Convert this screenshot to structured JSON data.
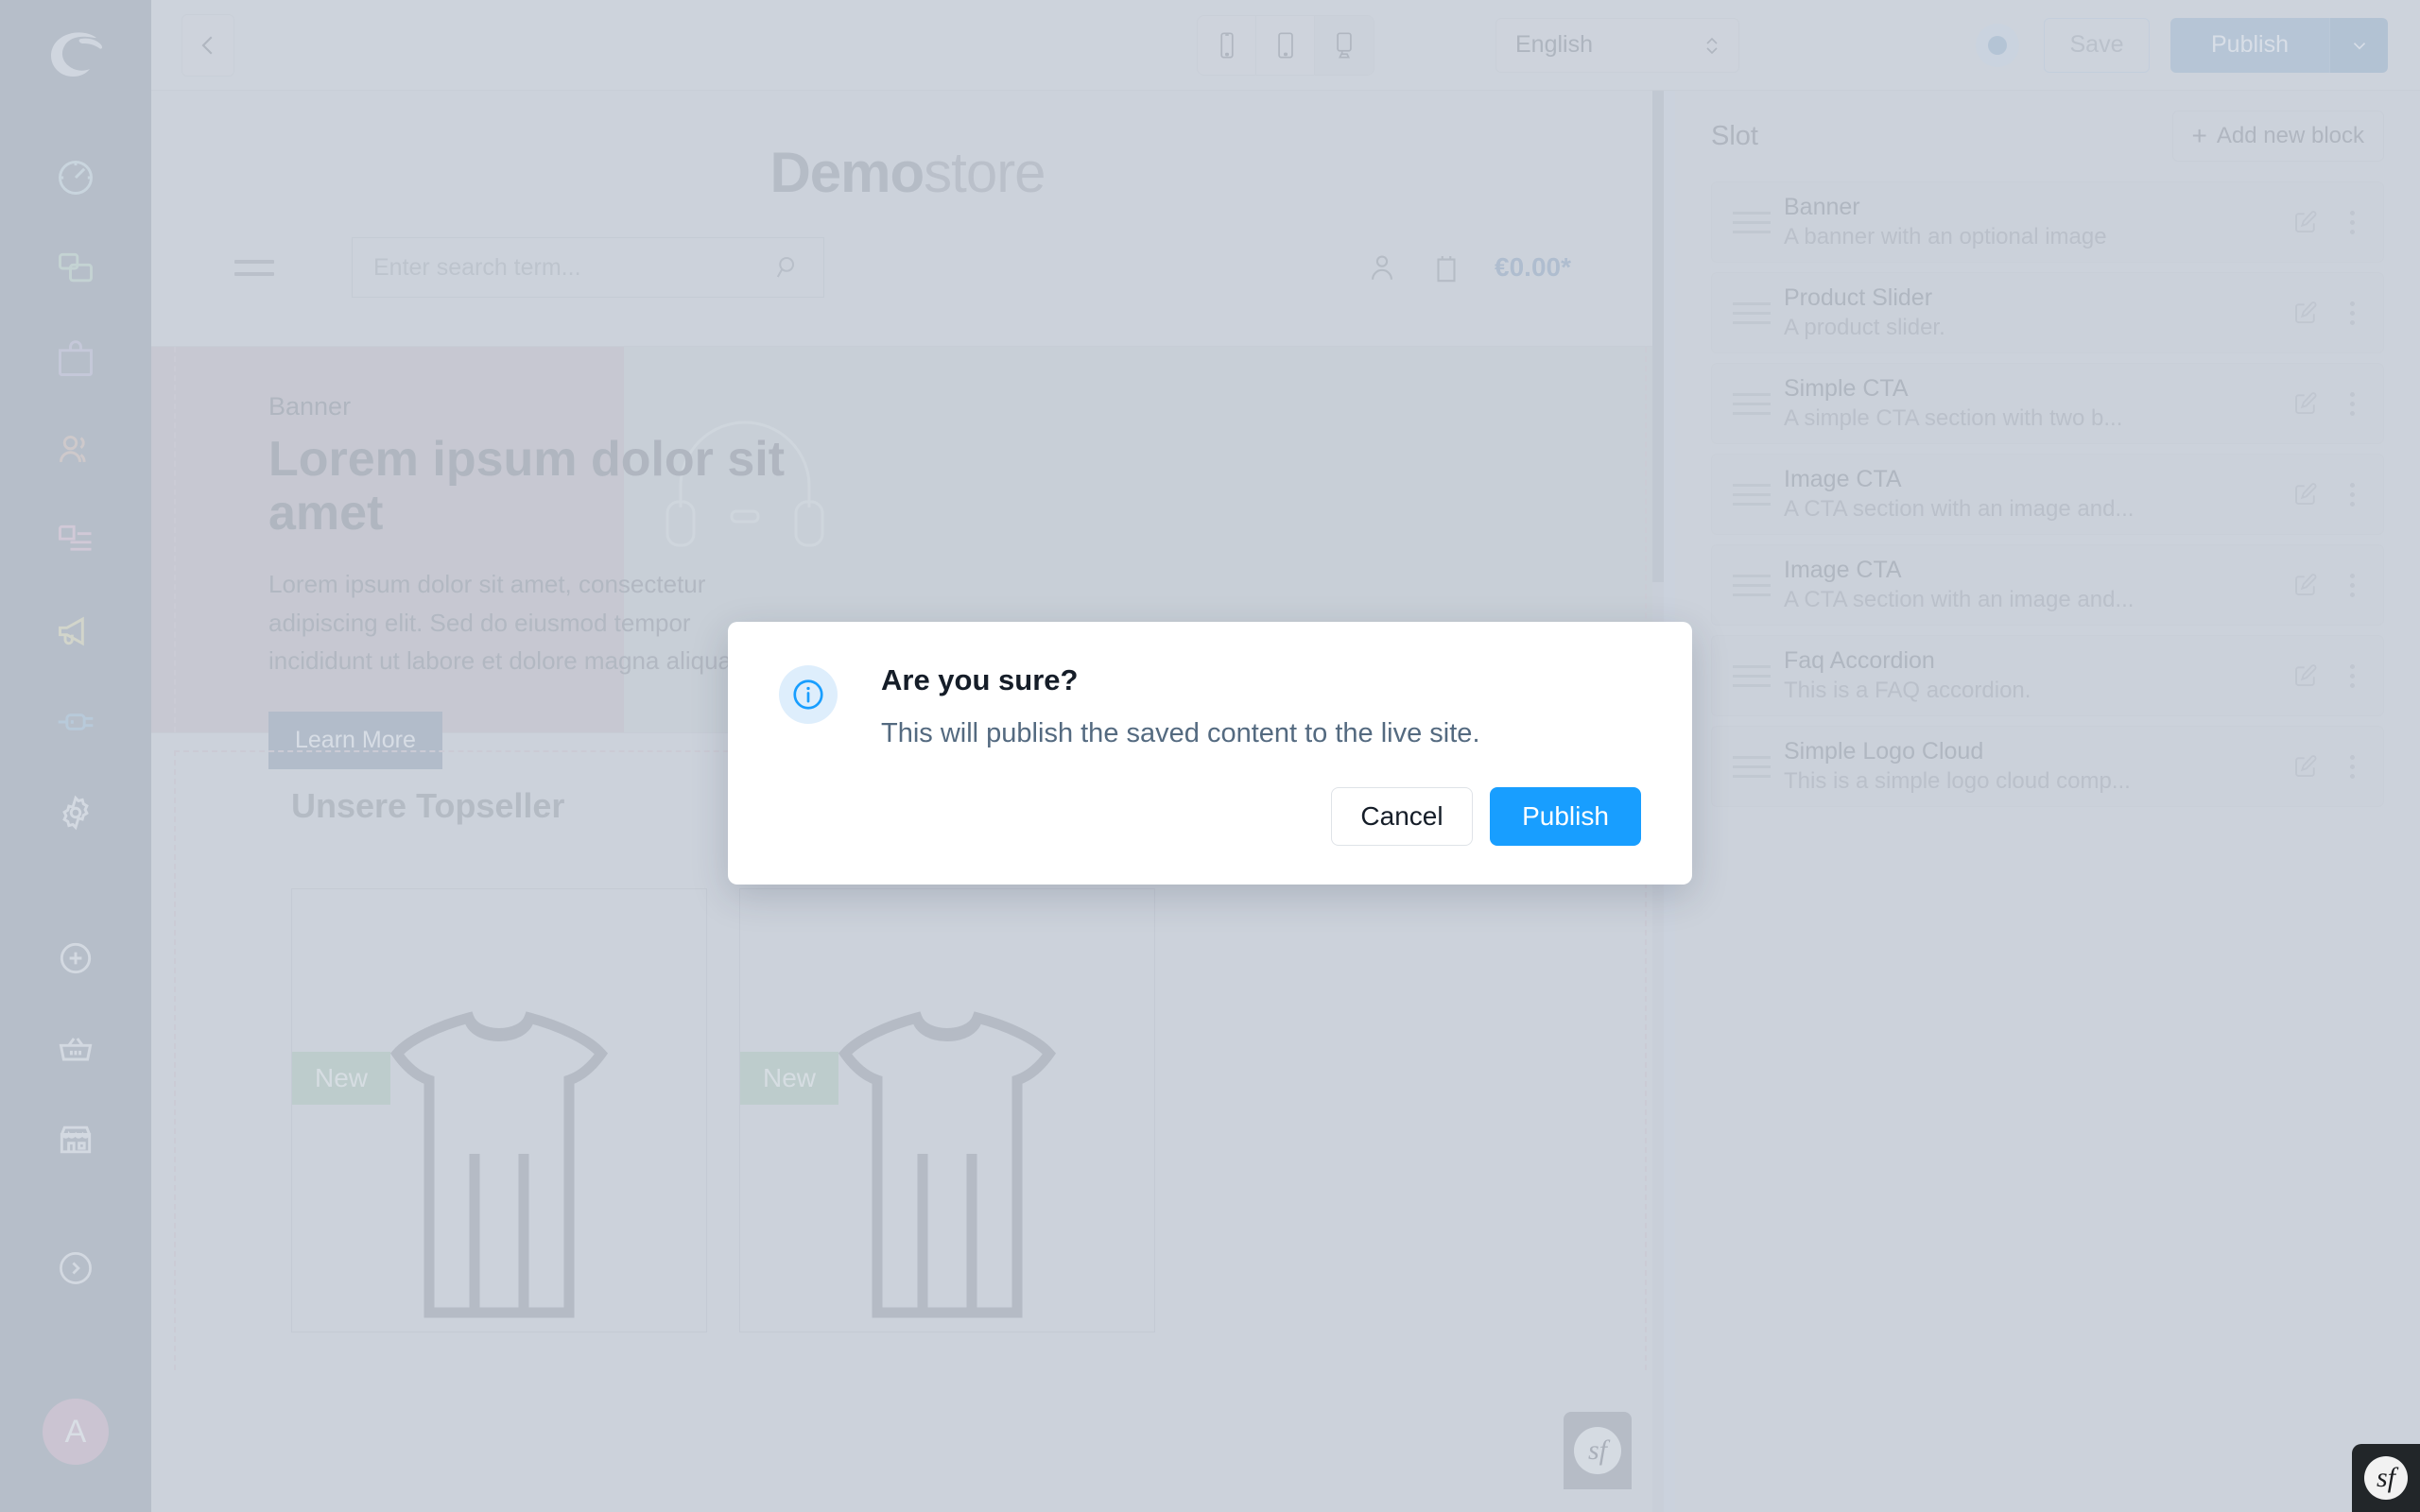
{
  "colors": {
    "sidebar_bg": "#8e9db3",
    "panel_bg": "#cbd2dd",
    "primary_blue": "#189eff",
    "publish_toolbar": "#7fb3e2",
    "badge_new_bg": "#95c7a8",
    "banner_left_bg": "#c5b7c2",
    "banner_right_bg": "#bdccd0",
    "avatar_bg": "#dba8c8"
  },
  "sidebar": {
    "logo_name": "shopware-logo",
    "items": [
      {
        "name": "dashboard",
        "icon": "speedometer-icon",
        "color": "#b9dde6"
      },
      {
        "name": "catalogues",
        "icon": "layers-icon",
        "color": "#a8dcba"
      },
      {
        "name": "orders",
        "icon": "shopping-bag-icon",
        "color": "#bdb4e8"
      },
      {
        "name": "customers",
        "icon": "users-icon",
        "color": "#e3b79e"
      },
      {
        "name": "content",
        "icon": "content-pages-icon",
        "color": "#edb4d4"
      },
      {
        "name": "marketing",
        "icon": "megaphone-icon",
        "color": "#e3dd8a"
      },
      {
        "name": "extensions",
        "icon": "plug-icon",
        "color": "#7fc2f0"
      },
      {
        "name": "settings",
        "icon": "gear-icon",
        "color": "#dfe4ea"
      }
    ],
    "quick_items": [
      {
        "name": "add",
        "icon": "plus-circle-icon"
      },
      {
        "name": "basket",
        "icon": "basket-icon"
      },
      {
        "name": "storefront",
        "icon": "store-icon"
      },
      {
        "name": "expand",
        "icon": "chevron-right-circle-icon"
      }
    ],
    "avatar_initial": "A"
  },
  "toolbar": {
    "back_icon": "arrow-left-icon",
    "devices": [
      {
        "label": "mobile",
        "icon": "mobile-icon",
        "active": false
      },
      {
        "label": "tablet",
        "icon": "tablet-icon",
        "active": false
      },
      {
        "label": "desktop",
        "icon": "desktop-icon",
        "active": true
      }
    ],
    "language": "English",
    "status_indicator": "unsaved-changes-dot",
    "save_label": "Save",
    "publish_label": "Publish",
    "publish_caret_icon": "chevron-down-icon"
  },
  "preview": {
    "store_logo_bold": "Demo",
    "store_logo_light": "store",
    "search_placeholder": "Enter search term...",
    "search_value": "",
    "cart_price": "€0.00*",
    "banner": {
      "eyebrow": "Banner",
      "heading": "Lorem ipsum dolor sit amet",
      "paragraph": "Lorem ipsum dolor sit amet, consectetur adipiscing elit. Sed do eiusmod tempor incididunt ut labore et dolore magna aliqua.",
      "button_label": "Learn More"
    },
    "topseller": {
      "title": "Unsere Topseller",
      "products": [
        {
          "badge": "New",
          "image": "shirt-placeholder-icon"
        },
        {
          "badge": "New",
          "image": "shirt-placeholder-icon"
        }
      ]
    },
    "symfony_badge": "sf"
  },
  "right_panel": {
    "title": "Slot",
    "add_block_label": "Add new block",
    "add_block_icon": "plus-icon",
    "blocks": [
      {
        "name": "Banner",
        "description": "A banner with an optional image"
      },
      {
        "name": "Product Slider",
        "description": "A product slider."
      },
      {
        "name": "Simple CTA",
        "description": "A simple CTA section with two b..."
      },
      {
        "name": "Image CTA",
        "description": "A CTA section with an image and..."
      },
      {
        "name": "Image CTA",
        "description": "A CTA section with an image and..."
      },
      {
        "name": "Faq Accordion",
        "description": "This is a FAQ accordion."
      },
      {
        "name": "Simple Logo Cloud",
        "description": "This is a simple logo cloud comp..."
      }
    ],
    "row_edit_icon": "pencil-edit-icon",
    "row_more_icon": "kebab-menu-icon"
  },
  "modal": {
    "icon": "info-circle-icon",
    "title": "Are you sure?",
    "text": "This will publish the saved content to the live site.",
    "cancel_label": "Cancel",
    "publish_label": "Publish"
  },
  "symfony_corner": {
    "label": "sf"
  }
}
